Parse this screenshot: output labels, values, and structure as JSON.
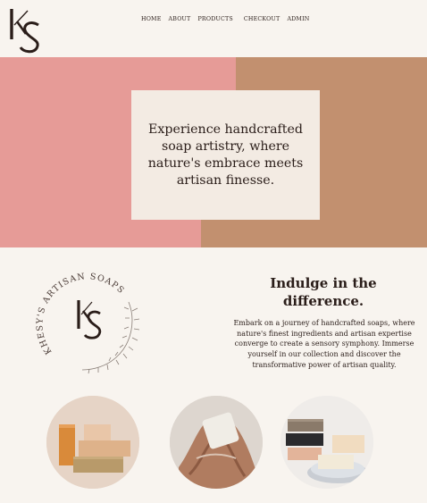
{
  "brand": {
    "logo_text": "KS"
  },
  "nav": {
    "items": [
      "HOME",
      "ABOUT",
      "PRODUCTS",
      "CHECKOUT",
      "ADMIN"
    ]
  },
  "hero": {
    "text": "Experience handcrafted soap artistry, where nature's embrace meets artisan finesse."
  },
  "badge": {
    "ring_text": "KHESY'S ARTISAN SOAPS",
    "monogram": "KS"
  },
  "intro": {
    "title": "Indulge in the difference.",
    "body": "Embark on a journey of handcrafted soaps, where nature's finest ingredients and artisan expertise converge to create a sensory symphony. Immerse yourself in our collection and discover the transformative power of artisan quality."
  },
  "colors": {
    "background": "#f8f4ef",
    "hero_pink": "#e69b97",
    "hero_tan": "#c2906f",
    "card": "#f3ebe3",
    "text": "#2a1d19"
  },
  "images": {
    "soap_stack": "stacked-soap-bars-image",
    "hands_soap": "hands-holding-soap-image",
    "soap_dish": "soap-dish-image"
  }
}
